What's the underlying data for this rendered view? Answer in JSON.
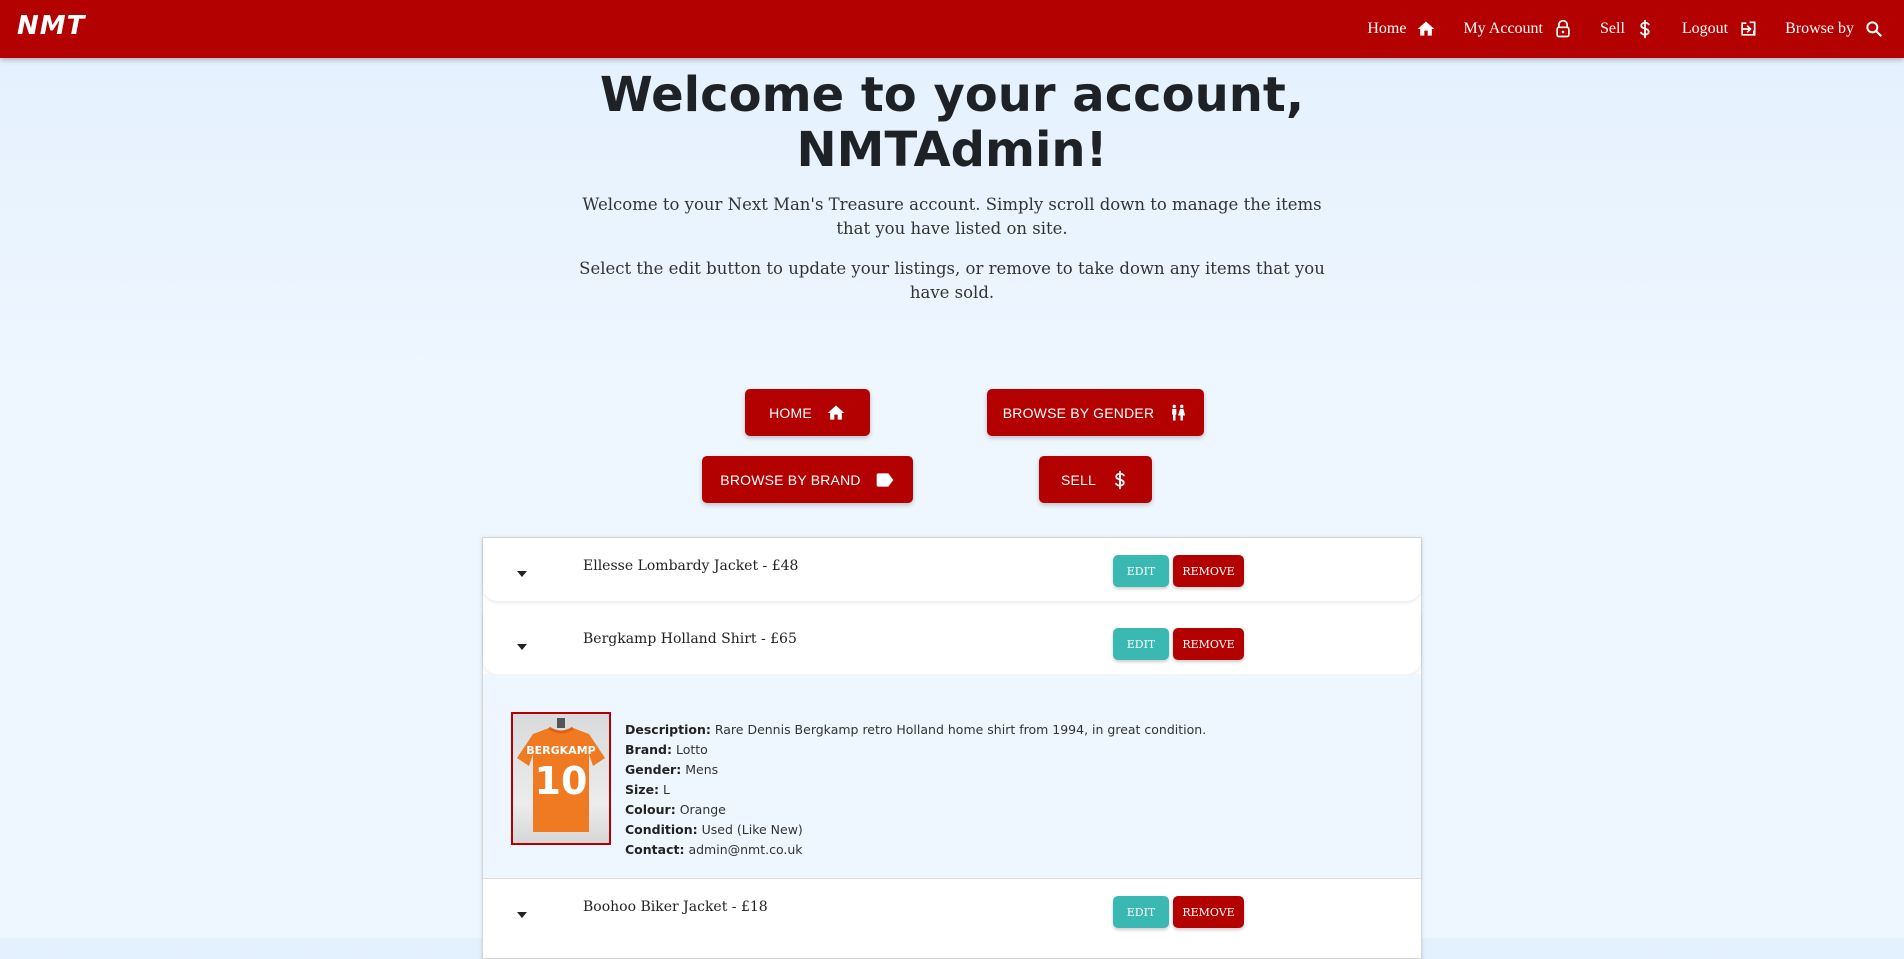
{
  "navbar": {
    "brand": "NMT",
    "links": [
      {
        "label": "Home",
        "icon": "home-icon"
      },
      {
        "label": "My Account",
        "icon": "lock-icon"
      },
      {
        "label": "Sell",
        "icon": "dollar-icon"
      },
      {
        "label": "Logout",
        "icon": "logout-icon"
      },
      {
        "label": "Browse by",
        "icon": "search-icon"
      }
    ]
  },
  "hero": {
    "title_line1": "Welcome to your account,",
    "title_line2": "NMTAdmin!",
    "intro1": "Welcome to your Next Man's Treasure account. Simply scroll down to manage the items that you have listed on site.",
    "intro2": "Select the edit button to update your listings, or remove to take down any items that you have sold."
  },
  "actions": {
    "home": "HOME",
    "gender": "BROWSE BY GENDER",
    "brand": "BROWSE BY BRAND",
    "sell": "SELL"
  },
  "items": [
    {
      "title": "Ellesse Lombardy Jacket - £48",
      "edit": "EDIT",
      "remove": "REMOVE"
    },
    {
      "title": "Bergkamp Holland Shirt - £65",
      "edit": "EDIT",
      "remove": "REMOVE"
    },
    {
      "title": "Boohoo Biker Jacket - £18",
      "edit": "EDIT",
      "remove": "REMOVE"
    }
  ],
  "expanded": {
    "shirt_name": "BERGKAMP",
    "shirt_number": "10",
    "fields": [
      {
        "label": "Description:",
        "value": "Rare Dennis Bergkamp retro Holland home shirt from 1994, in great condition."
      },
      {
        "label": "Brand:",
        "value": "Lotto"
      },
      {
        "label": "Gender:",
        "value": "Mens"
      },
      {
        "label": "Size:",
        "value": "L"
      },
      {
        "label": "Colour:",
        "value": "Orange"
      },
      {
        "label": "Condition:",
        "value": "Used (Like New)"
      },
      {
        "label": "Contact:",
        "value": "admin@nmt.co.uk"
      }
    ]
  },
  "colors": {
    "primary": "#b30000",
    "edit": "#3ab8b2",
    "background": "#eef6ff"
  }
}
